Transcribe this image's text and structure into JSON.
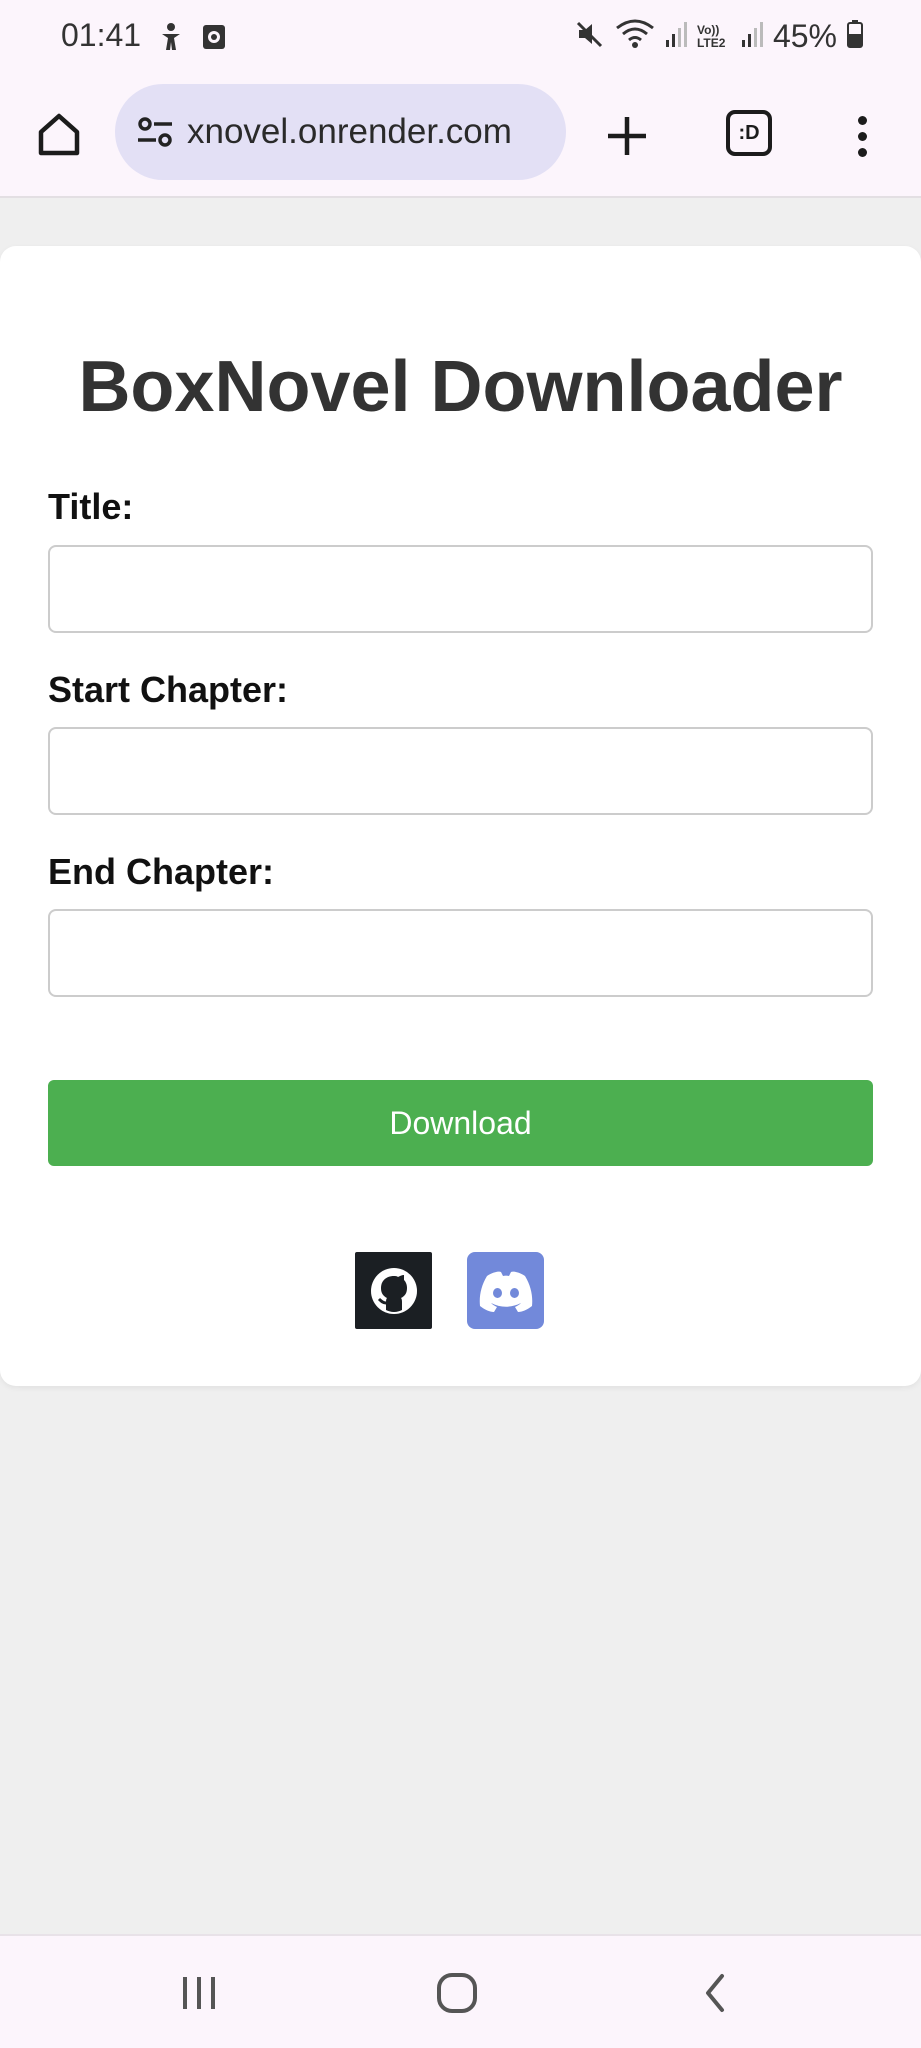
{
  "status_bar": {
    "time": "01:41",
    "battery_percent": "45%",
    "network_label": "Vo)) LTE2"
  },
  "browser": {
    "url": "xnovel.onrender.com",
    "tab_switcher_label": ":D"
  },
  "page": {
    "title": "BoxNovel Downloader",
    "fields": [
      {
        "label": "Title:",
        "value": "",
        "placeholder": ""
      },
      {
        "label": "Start Chapter:",
        "value": "",
        "placeholder": ""
      },
      {
        "label": "End Chapter:",
        "value": "",
        "placeholder": ""
      }
    ],
    "download_label": "Download",
    "social": [
      {
        "icon": "github-icon",
        "color": "#1b1f23"
      },
      {
        "icon": "discord-icon",
        "color": "#7289da"
      }
    ]
  },
  "colors": {
    "accent_green": "#4caf50",
    "discord_blue": "#7289da",
    "title_text": "#333333"
  }
}
